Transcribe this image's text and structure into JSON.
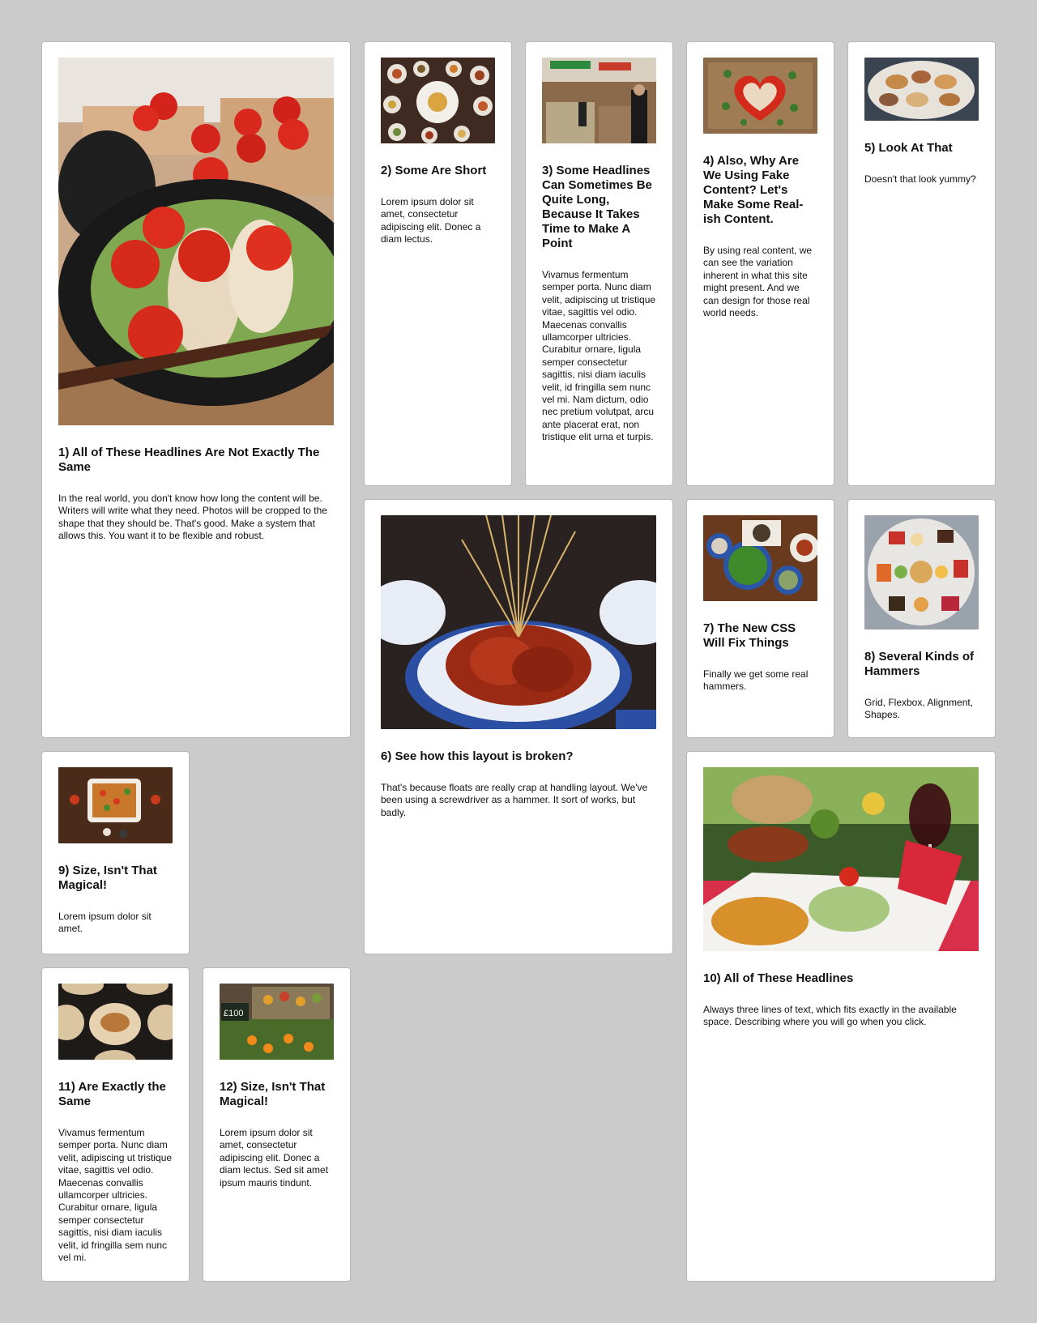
{
  "cards": [
    {
      "title": "1) All of These Headlines Are Not Exactly The Same",
      "body": "In the real world, you don't know how long the content will be. Writers will write what they need. Photos will be cropped to the shape that they should be. That's good. Make a system that allows this. You want it to be flexible and robust.",
      "image": "tomatoes-fish-pan"
    },
    {
      "title": "2) Some Are Short",
      "body": "Lorem ipsum dolor sit amet, consectetur adipiscing elit. Donec a diam lectus.",
      "image": "thali-spread"
    },
    {
      "title": "3) Some Headlines Can Sometimes Be Quite Long, Because It Takes Time to Make A Point",
      "body": "Vivamus fermentum semper porta. Nunc diam velit, adipiscing ut tristique vitae, sagittis vel odio. Maecenas convallis ullamcorper ultricies. Curabitur ornare, ligula semper consectetur sagittis, nisi diam iaculis velit, id fringilla sem nunc vel mi. Nam dictum, odio nec pretium volutpat, arcu ante placerat erat, non tristique elit urna et turpis.",
      "image": "food-market"
    },
    {
      "title": "4) Also, Why Are We Using Fake Content? Let's Make Some Real-ish Content.",
      "body": "By using real content, we can see the variation inherent in what this site might present. And we can design for those real world needs.",
      "image": "pepper-heart"
    },
    {
      "title": "5) Look At That",
      "body": "Doesn't that look yummy?",
      "image": "seafood-platter"
    },
    {
      "title": "6) See how this layout is broken?",
      "body": "That's because floats are really crap at handling layout. We've been using a screwdriver as a hammer. It sort of works, but badly.",
      "image": "skewers-bowl"
    },
    {
      "title": "7) The New CSS Will Fix Things",
      "body": "Finally we get some real hammers.",
      "image": "dining-table"
    },
    {
      "title": "8) Several Kinds of Hammers",
      "body": "Grid, Flexbox, Alignment, Shapes.",
      "image": "dessert-platter"
    },
    {
      "title": "9) Size, Isn't That Magical!",
      "body": "Lorem ipsum dolor sit amet.",
      "image": "casserole-dish"
    },
    {
      "title": "10) All of These Headlines",
      "body": "Always three lines of text, which fits exactly in the available space. Describing where you will go when you click.",
      "image": "mexican-meal"
    },
    {
      "title": "11) Are Exactly the Same",
      "body": "Vivamus fermentum semper porta. Nunc diam velit, adipiscing ut tristique vitae, sagittis vel odio. Maecenas convallis ullamcorper ultricies. Curabitur ornare, ligula semper consectetur sagittis, nisi diam iaculis velit, id fringilla sem nunc vel mi.",
      "image": "flatbreads"
    },
    {
      "title": "12) Size, Isn't That Magical!",
      "body": "Lorem ipsum dolor sit amet, consectetur adipiscing elit. Donec a diam lectus. Sed sit amet ipsum mauris tindunt.",
      "image": "fruit-stall",
      "image_caption": "£100"
    }
  ]
}
